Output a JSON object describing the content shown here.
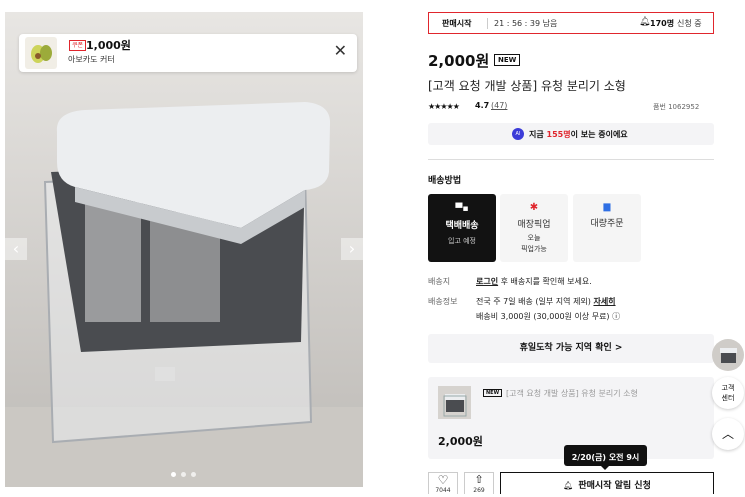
{
  "toast": {
    "badge": "쿠폰",
    "price": "1,000원",
    "name": "아보카도 커터"
  },
  "timer": {
    "label": "판매시작",
    "time": "21 : 56 : 39 남음",
    "count": "170명",
    "count_suffix": "신청 중"
  },
  "product": {
    "price": "2,000원",
    "new_badge": "NEW",
    "title": "[고객 요청 개발 상품] 유청 분리기 소형",
    "rating": "4.7",
    "reviews": "(47)",
    "product_no": "품번 1062952"
  },
  "viewers": {
    "prefix": "지금 ",
    "count": "155명",
    "suffix": "이 보는 중이에요",
    "ai": "AI"
  },
  "shipping": {
    "heading": "배송방법",
    "methods": [
      {
        "title": "택배배송",
        "sub": "입고 예정",
        "icon": "truck-icon",
        "color": "#ffffff"
      },
      {
        "title": "매장픽업",
        "sub": "오늘\n픽업가능",
        "icon": "pin-icon",
        "color": "#e0262d"
      },
      {
        "title": "대량주문",
        "sub": "",
        "icon": "box-icon",
        "color": "#2f6fe4"
      }
    ],
    "dest_label": "배송지",
    "dest_login": "로그인",
    "dest_text": " 후 배송지를 확인해 보세요.",
    "info_label": "배송정보",
    "info_text": "전국 주 7일 배송 (일부 지역 제외) ",
    "info_link": "자세히",
    "fee_text": "배송비 3,000원 (30,000원 이상 무료)",
    "holiday": "휴일도착 가능 지역 확인 >"
  },
  "option": {
    "badge": "NEW",
    "title": "[고객 요청 개발 상품] 유청 분리기 소형",
    "price": "2,000원"
  },
  "tooltip": "2/20(금) 오전 9시",
  "actions": {
    "like_count": "7044",
    "share_count": "269",
    "alert": "판매시작 알림 신청"
  },
  "side": {
    "cs": "고객\n센터"
  }
}
